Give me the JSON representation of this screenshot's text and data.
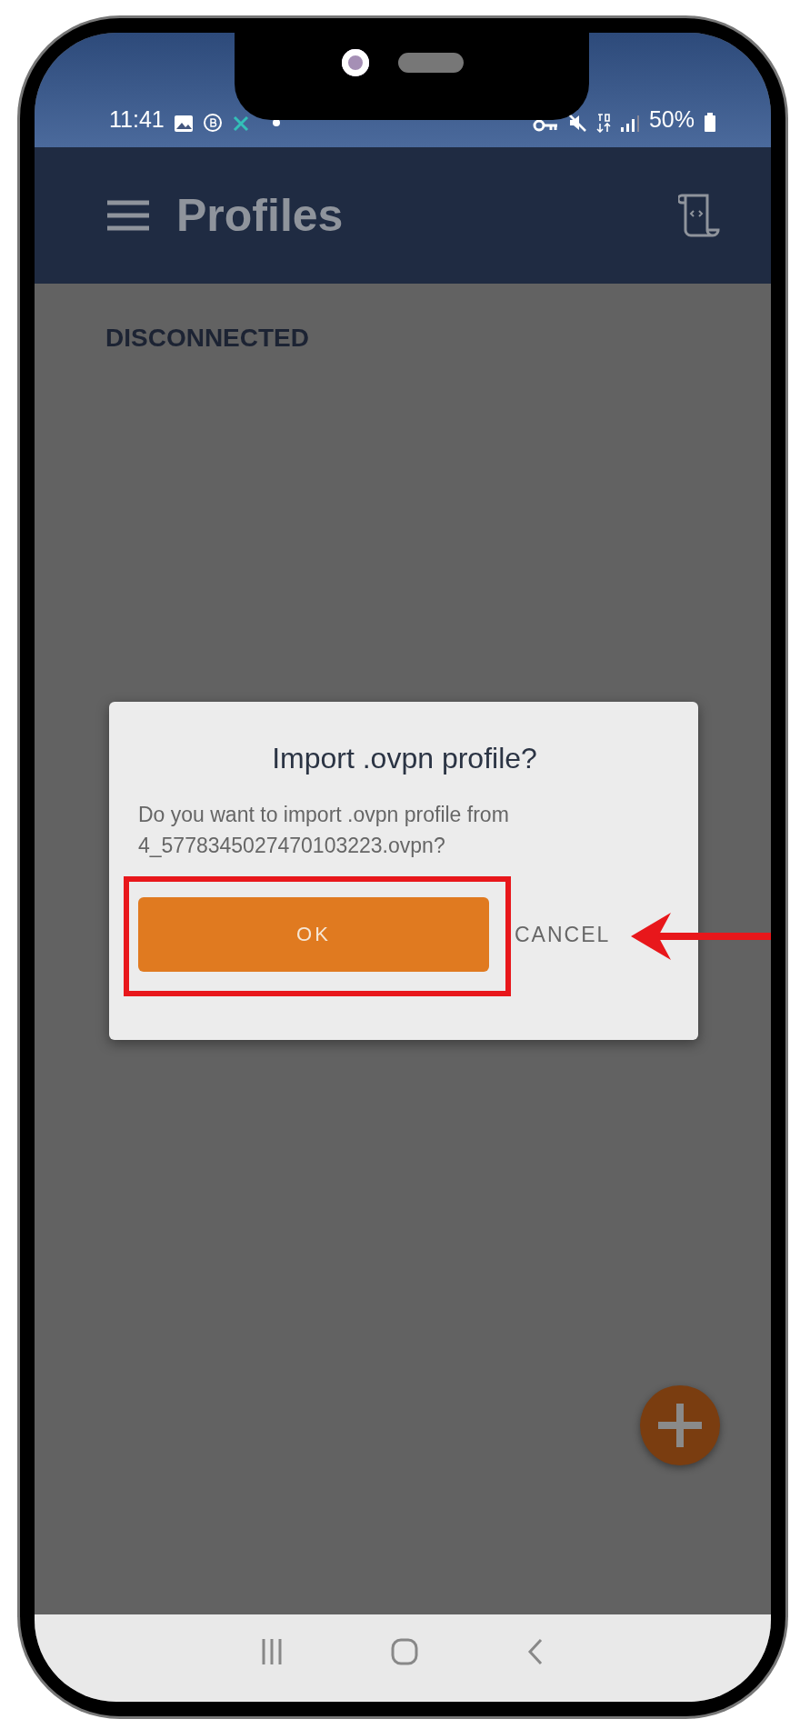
{
  "status_bar": {
    "time": "11:41",
    "battery": "50%"
  },
  "app_bar": {
    "title": "Profiles"
  },
  "connection_status": "DISCONNECTED",
  "dialog": {
    "title": "Import .ovpn profile?",
    "message": "Do you want to import .ovpn profile from 4_5778345027470103223.ovpn?",
    "buttons": [
      {
        "label": "OK",
        "kind": "filled"
      },
      {
        "label": "CANCEL",
        "kind": "text"
      }
    ]
  }
}
